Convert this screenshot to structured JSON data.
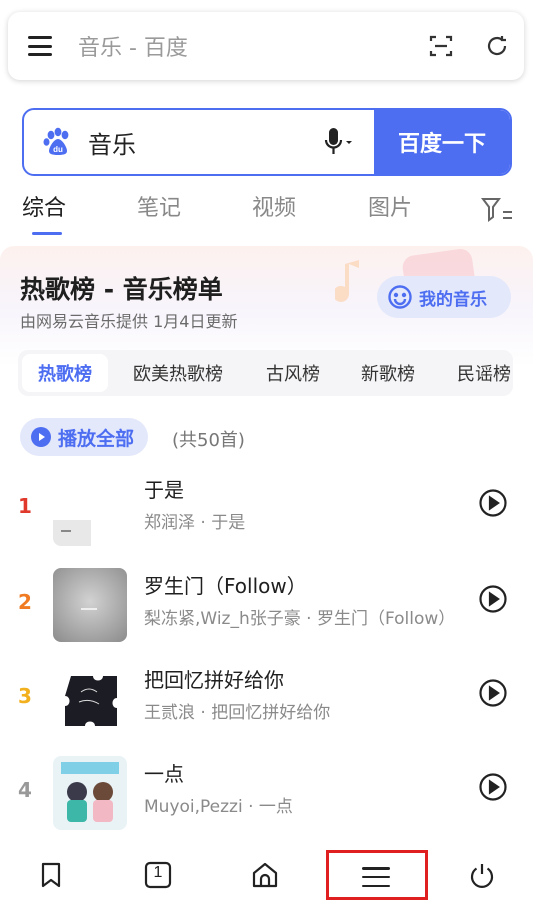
{
  "address_bar": {
    "title": "音乐 - 百度",
    "menu_icon": "hamburger-icon",
    "scan_icon": "scan-icon",
    "refresh_icon": "refresh-icon"
  },
  "search": {
    "query": "音乐",
    "button_label": "百度一下",
    "logo": "baidu-paw-icon",
    "voice_icon": "microphone-icon"
  },
  "tabs": [
    {
      "label": "综合",
      "active": true
    },
    {
      "label": "笔记",
      "active": false
    },
    {
      "label": "视频",
      "active": false
    },
    {
      "label": "图片",
      "active": false
    }
  ],
  "card": {
    "title": "热歌榜 - 音乐榜单",
    "subtitle": "由网易云音乐提供 1月4日更新",
    "my_music_label": "我的音乐",
    "chips": [
      {
        "label": "热歌榜",
        "active": true
      },
      {
        "label": "欧美热歌榜",
        "active": false
      },
      {
        "label": "古风榜",
        "active": false
      },
      {
        "label": "新歌榜",
        "active": false
      },
      {
        "label": "民谣榜",
        "active": false
      }
    ],
    "play_all_label": "播放全部",
    "count_label": "(共50首)",
    "songs": [
      {
        "rank": "1",
        "name": "于是",
        "meta": "郑润泽 · 于是",
        "rank_color": "#e0392b"
      },
      {
        "rank": "2",
        "name": "罗生门（Follow）",
        "meta": "梨冻紧,Wiz_h张子豪 · 罗生门（Follow）",
        "rank_color": "#f07b22"
      },
      {
        "rank": "3",
        "name": "把回忆拼好给你",
        "meta": "王贰浪 · 把回忆拼好给你",
        "rank_color": "#f2b01e"
      },
      {
        "rank": "4",
        "name": "一点",
        "meta": "Muyoi,Pezzi · 一点",
        "rank_color": "#999999"
      }
    ]
  },
  "bottom_nav": {
    "items": [
      "bookmark-icon",
      "tabs-count-icon",
      "home-icon",
      "menu-icon",
      "power-icon"
    ],
    "tab_count": "1"
  },
  "colors": {
    "accent": "#4e6ef2",
    "highlight": "#e02020"
  }
}
